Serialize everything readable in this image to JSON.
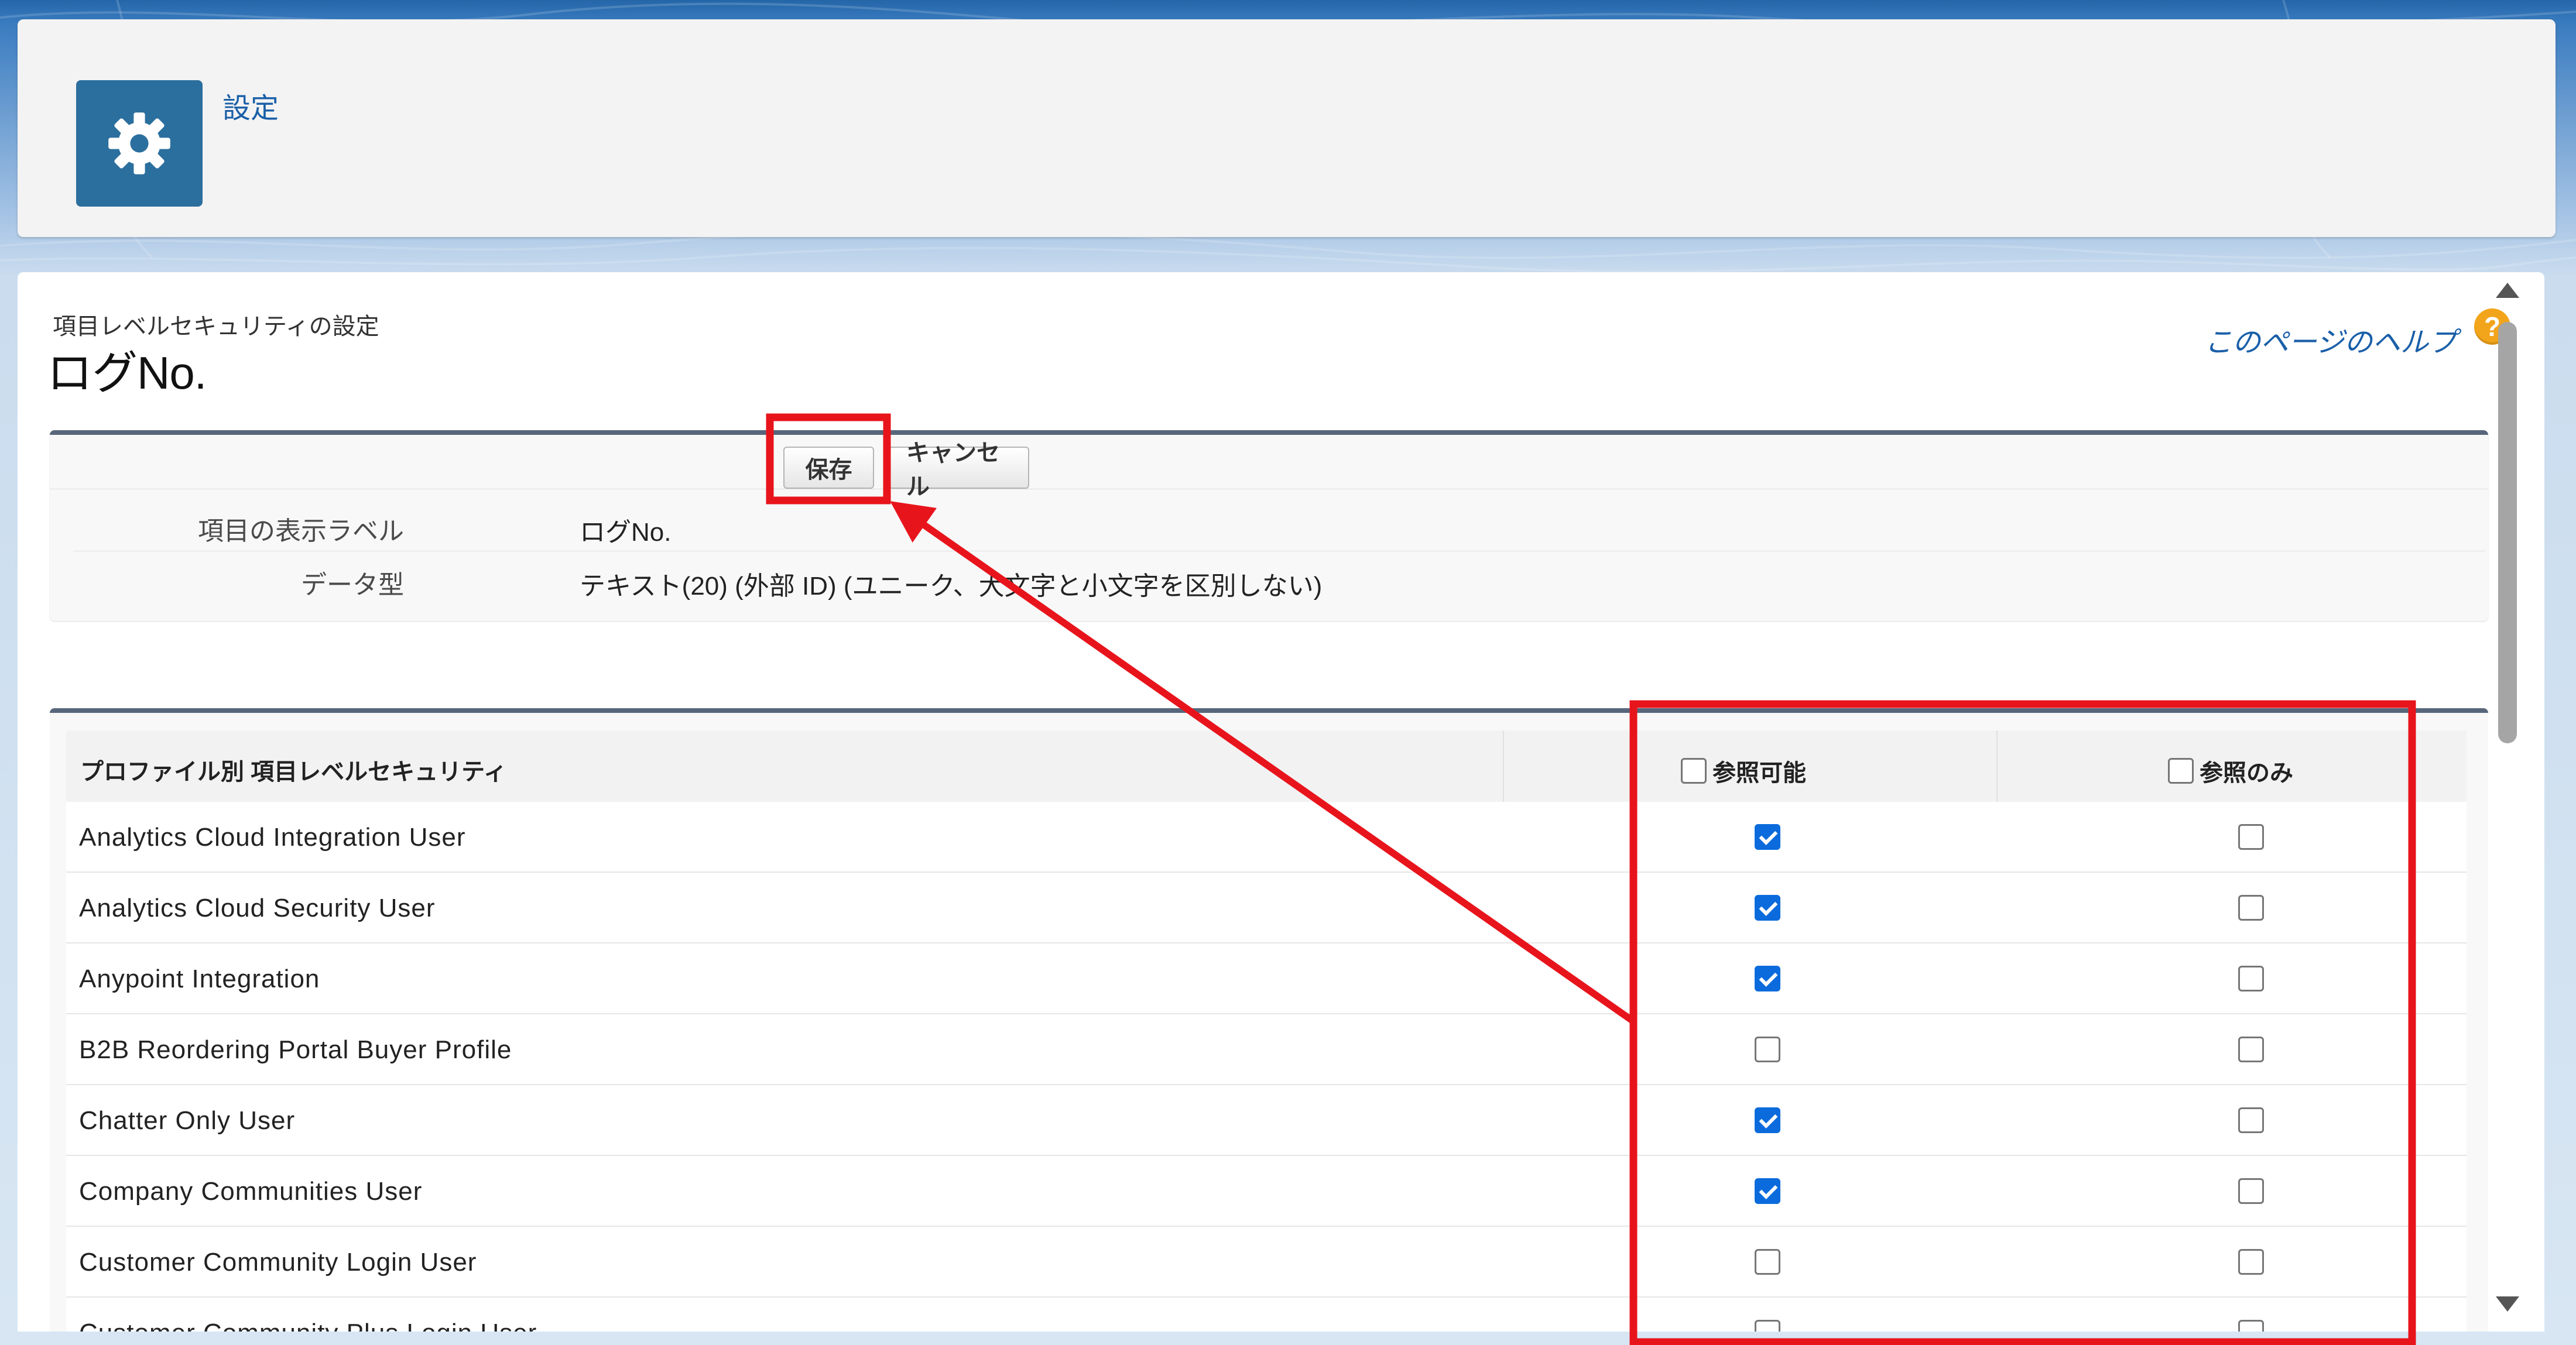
{
  "header": {
    "breadcrumb": "設定",
    "icon": "gear-icon",
    "icon_bg": "#2b6f9e"
  },
  "page": {
    "subtitle": "項目レベルセキュリティの設定",
    "title": "ログNo.",
    "help_link": "このページのヘルプ",
    "help_icon": "?"
  },
  "buttons": {
    "save": "保存",
    "cancel": "キャンセル"
  },
  "details": [
    {
      "label": "項目の表示ラベル",
      "value": "ログNo."
    },
    {
      "label": "データ型",
      "value": "テキスト(20) (外部 ID) (ユニーク、大文字と小文字を区別しない)"
    }
  ],
  "table": {
    "header_profile": "プロファイル別 項目レベルセキュリティ",
    "header_readable": "参照可能",
    "header_readonly": "参照のみ",
    "rows": [
      {
        "name": "Analytics Cloud Integration User",
        "readable": true,
        "readonly": false
      },
      {
        "name": "Analytics Cloud Security User",
        "readable": true,
        "readonly": false
      },
      {
        "name": "Anypoint Integration",
        "readable": true,
        "readonly": false
      },
      {
        "name": "B2B Reordering Portal Buyer Profile",
        "readable": false,
        "readonly": false
      },
      {
        "name": "Chatter Only User",
        "readable": true,
        "readonly": false
      },
      {
        "name": "Company Communities User",
        "readable": true,
        "readonly": false
      },
      {
        "name": "Customer Community Login User",
        "readable": false,
        "readonly": false
      },
      {
        "name": "Customer Community Plus Login User",
        "readable": false,
        "readonly": false
      }
    ]
  },
  "colors": {
    "annotation": "#e8141c",
    "checkbox_checked": "#0b6bdc",
    "link": "#1a5fa8"
  }
}
